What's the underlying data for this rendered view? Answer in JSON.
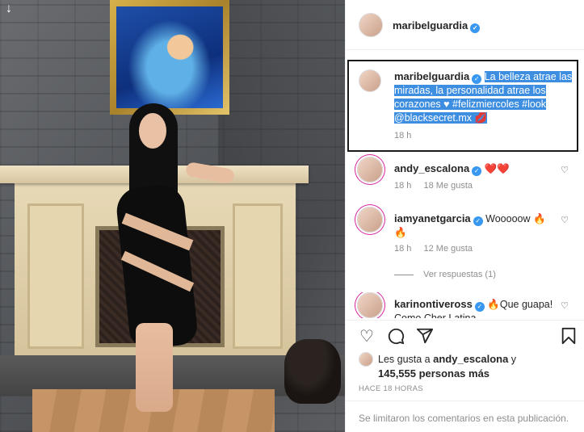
{
  "post": {
    "author": "maribelguardia",
    "caption_user": "maribelguardia",
    "caption_highlighted": "La belleza atrae las miradas, la personalidad atrae los corazones ♥ #felizmiercoles #look @blacksecret.mx 💋",
    "caption_time": "18 h"
  },
  "icons": {
    "verified": "verified-badge-icon",
    "back": "down-arrow-icon",
    "like": "heart-icon",
    "comment": "comment-icon",
    "share": "share-icon",
    "save": "bookmark-icon"
  },
  "comments": [
    {
      "user": "andy_escalona",
      "text": "❤️❤️",
      "time": "18 h",
      "likes": "18 Me gusta"
    },
    {
      "user": "iamyanetgarcia",
      "text": "Wooooow 🔥\n🔥",
      "time": "18 h",
      "likes": "12 Me gusta"
    },
    {
      "user": "karinontiveross",
      "text": "🔥Que guapa!\nComo Cher Latina"
    }
  ],
  "replies_label": "Ver respuestas (1)",
  "likes": {
    "prefix": "Les gusta a ",
    "user": "andy_escalona",
    "suffix": " y",
    "count": "145,555 personas más"
  },
  "posted_ago": "HACE 18 HORAS",
  "comments_disabled": "Se limitaron los comentarios en esta publicación.",
  "colors": {
    "highlight": "#3d8ee0",
    "verified": "#3897f0",
    "heart": "#ed4956"
  }
}
